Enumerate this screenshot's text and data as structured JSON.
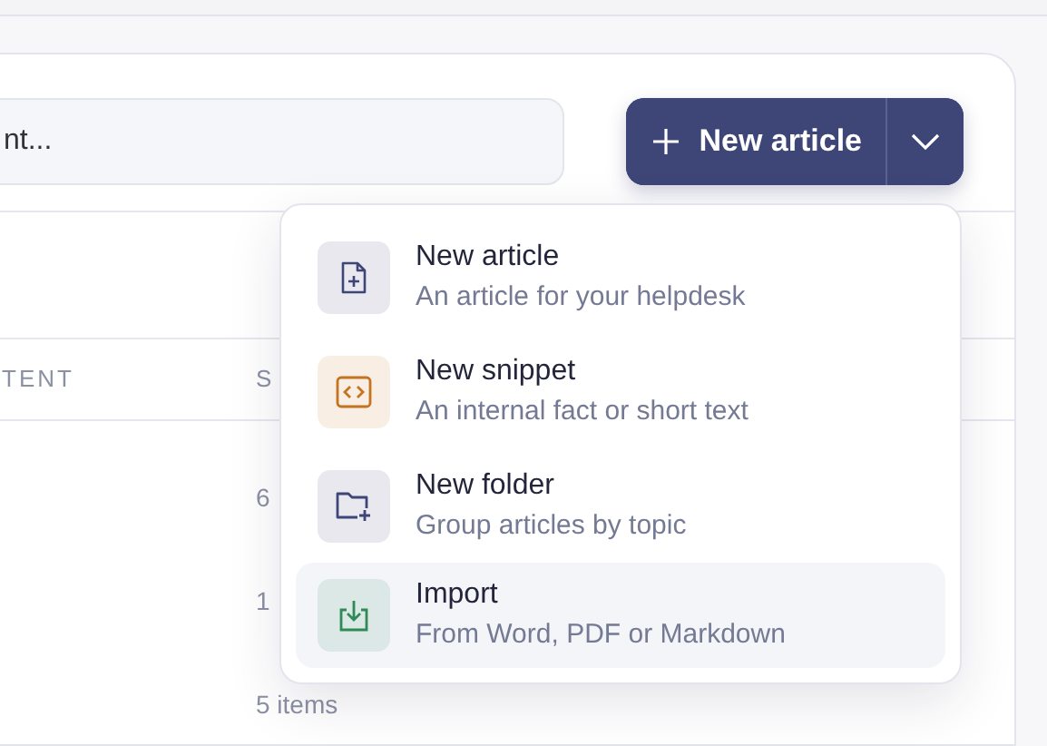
{
  "search": {
    "placeholder": "nt..."
  },
  "new_button": {
    "label": "New article"
  },
  "table": {
    "columns": [
      "TENT",
      "S"
    ],
    "rows": [
      [
        "",
        "6"
      ],
      [
        "",
        "1"
      ],
      [
        "",
        "5 items"
      ]
    ]
  },
  "menu": {
    "items": [
      {
        "kind": "article",
        "title": "New article",
        "description": "An article for your helpdesk",
        "color": "#3e4577",
        "highlighted": false
      },
      {
        "kind": "snippet",
        "title": "New snippet",
        "description": "An internal fact or short text",
        "color": "#c4731f",
        "highlighted": false
      },
      {
        "kind": "folder",
        "title": "New folder",
        "description": "Group articles by topic",
        "color": "#3e4577",
        "highlighted": false
      },
      {
        "kind": "import",
        "title": "Import",
        "description": "From Word, PDF or Markdown",
        "color": "#2e8b57",
        "highlighted": true
      }
    ]
  }
}
